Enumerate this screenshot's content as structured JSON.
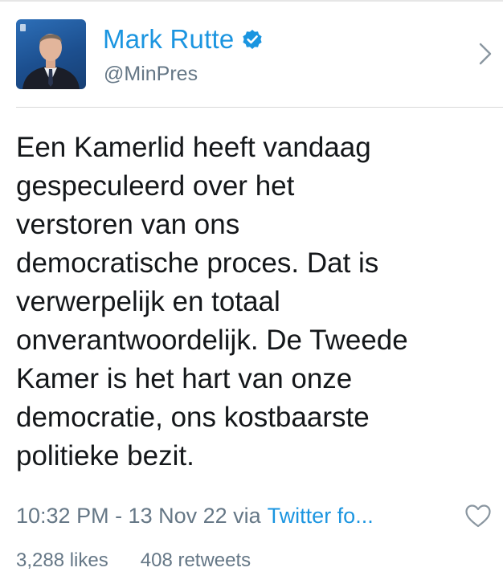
{
  "profile": {
    "display_name": "Mark Rutte",
    "handle": "@MinPres",
    "verified": true
  },
  "tweet": {
    "text": "Een Kamerlid heeft vandaag gespeculeerd over het verstoren van ons democratische proces. Dat is verwerpelijk en totaal onverantwoordelijk. De Tweede Kamer is het hart van onze democratie, ons kostbaarste politieke bezit.",
    "lines": [
      "Een Kamerlid heeft vandaag",
      "gespeculeerd over het",
      "verstoren van ons",
      "democratische proces. Dat is",
      "verwerpelijk en totaal",
      "onverantwoordelijk. De Tweede",
      "Kamer is het hart van onze",
      "democratie, ons kostbaarste",
      "politieke bezit."
    ],
    "timestamp": "10:32 PM - 13 Nov 22 via",
    "source": "Twitter fo...",
    "likes": "3,288 likes",
    "retweets": "408 retweets"
  },
  "icons": {
    "verified": "verified-badge-icon",
    "chevron": "chevron-right-icon",
    "like": "heart-outline-icon"
  },
  "colors": {
    "link_blue": "#1b95e0",
    "secondary_gray": "#657786",
    "text": "#14171a"
  }
}
